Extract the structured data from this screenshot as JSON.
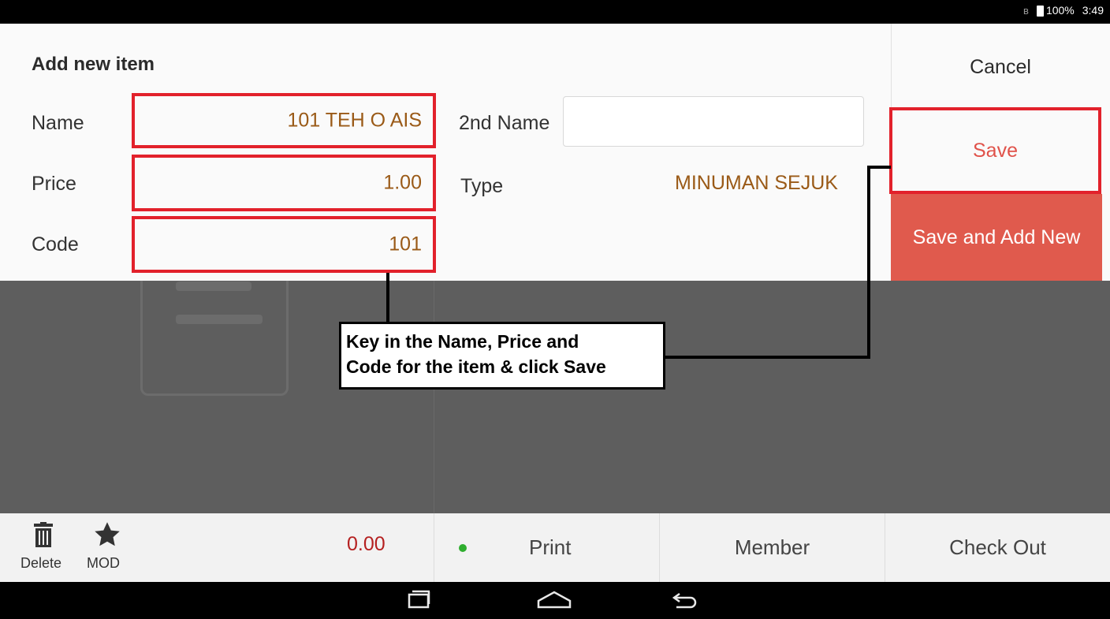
{
  "status_bar": {
    "battery": "100%",
    "time": "3:49"
  },
  "dialog": {
    "title": "Add new item",
    "labels": {
      "name": "Name",
      "price": "Price",
      "code": "Code",
      "second_name": "2nd Name",
      "type": "Type"
    },
    "values": {
      "name": "101 TEH O AIS",
      "price": "1.00",
      "code": "101",
      "second_name": "",
      "type": "MINUMAN SEJUK"
    },
    "buttons": {
      "cancel": "Cancel",
      "save": "Save",
      "save_and_add_new": "Save and Add New"
    }
  },
  "annotation": {
    "line1": "Key in the Name, Price and",
    "line2": "Code for the item & click Save"
  },
  "bottom_bar": {
    "delete": "Delete",
    "mod": "MOD",
    "total": "0.00",
    "print": "Print",
    "member": "Member",
    "check_out": "Check Out"
  },
  "colors": {
    "highlight": "#e2212b",
    "accent": "#e05a4d",
    "value_text": "#9a5a17",
    "total": "#b52020"
  }
}
